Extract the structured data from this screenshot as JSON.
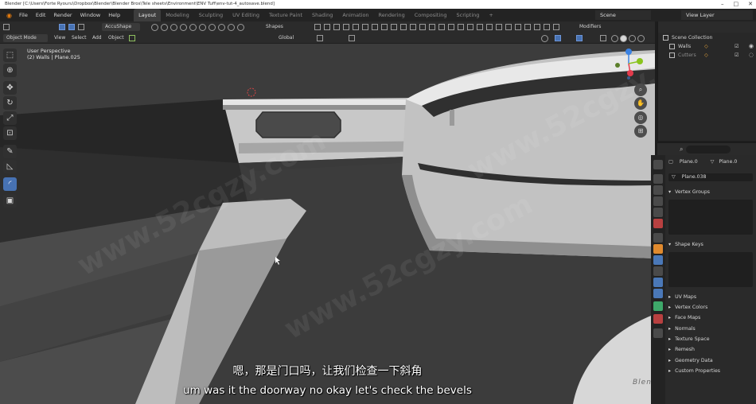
{
  "window": {
    "title": "Blender [C:\\Users\\Forte Ryouru\\Dropbox\\Blender\\Blender Bros\\Tele sheets\\Environment\\ENV Tuff\\env-tut-4_autosave.blend]",
    "controls": [
      "–",
      "□",
      "✕"
    ]
  },
  "menu": [
    "File",
    "Edit",
    "Render",
    "Window",
    "Help"
  ],
  "workspaces": [
    "Layout",
    "Modeling",
    "Sculpting",
    "UV Editing",
    "Texture Paint",
    "Shading",
    "Animation",
    "Rendering",
    "Compositing",
    "Scripting",
    "+"
  ],
  "active_workspace": "Layout",
  "scene": "Scene",
  "view_layer": "View Layer",
  "tool_header": {
    "accushape": "AccuShape",
    "shapes": "Shapes",
    "modifiers": "Modifiers"
  },
  "viewport_header": {
    "mode": "Object Mode",
    "menus": [
      "View",
      "Select",
      "Add",
      "Object"
    ],
    "orientation": "Global"
  },
  "viewport": {
    "perspective": "User Perspective",
    "collection_info": "(2) Walls | Plane.025"
  },
  "gizmo": {
    "z": "Z",
    "y": "Y",
    "x": "X"
  },
  "subtitles": {
    "chinese": "嗯，那是门口吗，让我们检查一下斜角",
    "english": "um was it the doorway no okay let's check the bevels"
  },
  "watermark": {
    "brand": "Blender Bros",
    "site": "www.52cgzy.com"
  },
  "outliner": {
    "root": "Scene Collection",
    "items": [
      "Walls",
      "Cutters"
    ]
  },
  "properties": {
    "object": "Plane.0",
    "data": "Plane.0",
    "mesh": "Plane.038",
    "panels_open": [
      "Vertex Groups",
      "Shape Keys"
    ],
    "panels_closed": [
      "UV Maps",
      "Vertex Colors",
      "Face Maps",
      "Normals",
      "Texture Space",
      "Remesh",
      "Geometry Data",
      "Custom Properties"
    ]
  },
  "colors": {
    "accent": "#4772b3",
    "gizmo_x": "#e33b4c",
    "gizmo_y": "#8ac41d",
    "gizmo_z": "#3b82e3"
  }
}
